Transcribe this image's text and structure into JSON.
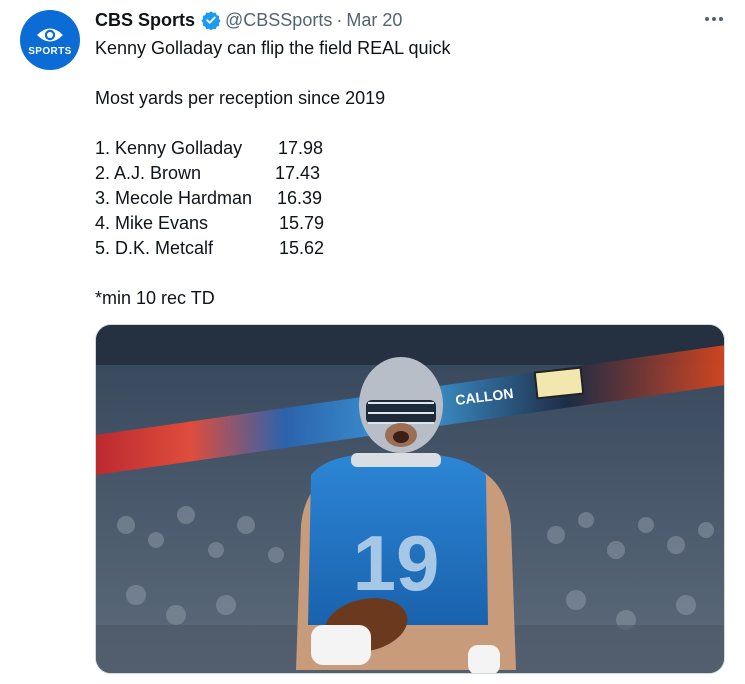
{
  "account": {
    "name": "CBS Sports",
    "handle": "@CBSSports",
    "separator": "·",
    "date": "Mar 20",
    "avatar_text": "SPORTS",
    "verified_icon": "verified-badge-icon",
    "brand_color": "#0b6cd6"
  },
  "tweet": {
    "headline": "Kenny Golladay can flip the field REAL quick",
    "list_title": "Most yards per reception since 2019",
    "rankings": [
      {
        "label": "1. Kenny Golladay",
        "value": "17.98"
      },
      {
        "label": "2. A.J. Brown",
        "value": "17.43"
      },
      {
        "label": "3. Mecole Hardman",
        "value": "16.39"
      },
      {
        "label": "4. Mike Evans",
        "value": "15.79"
      },
      {
        "label": "5. D.K. Metcalf",
        "value": "15.62"
      }
    ],
    "footnote": "*min 10 rec TD"
  },
  "media": {
    "jersey_number": "19",
    "jersey_color": "#1f77c9",
    "scoreboard_text": "CALLON"
  }
}
